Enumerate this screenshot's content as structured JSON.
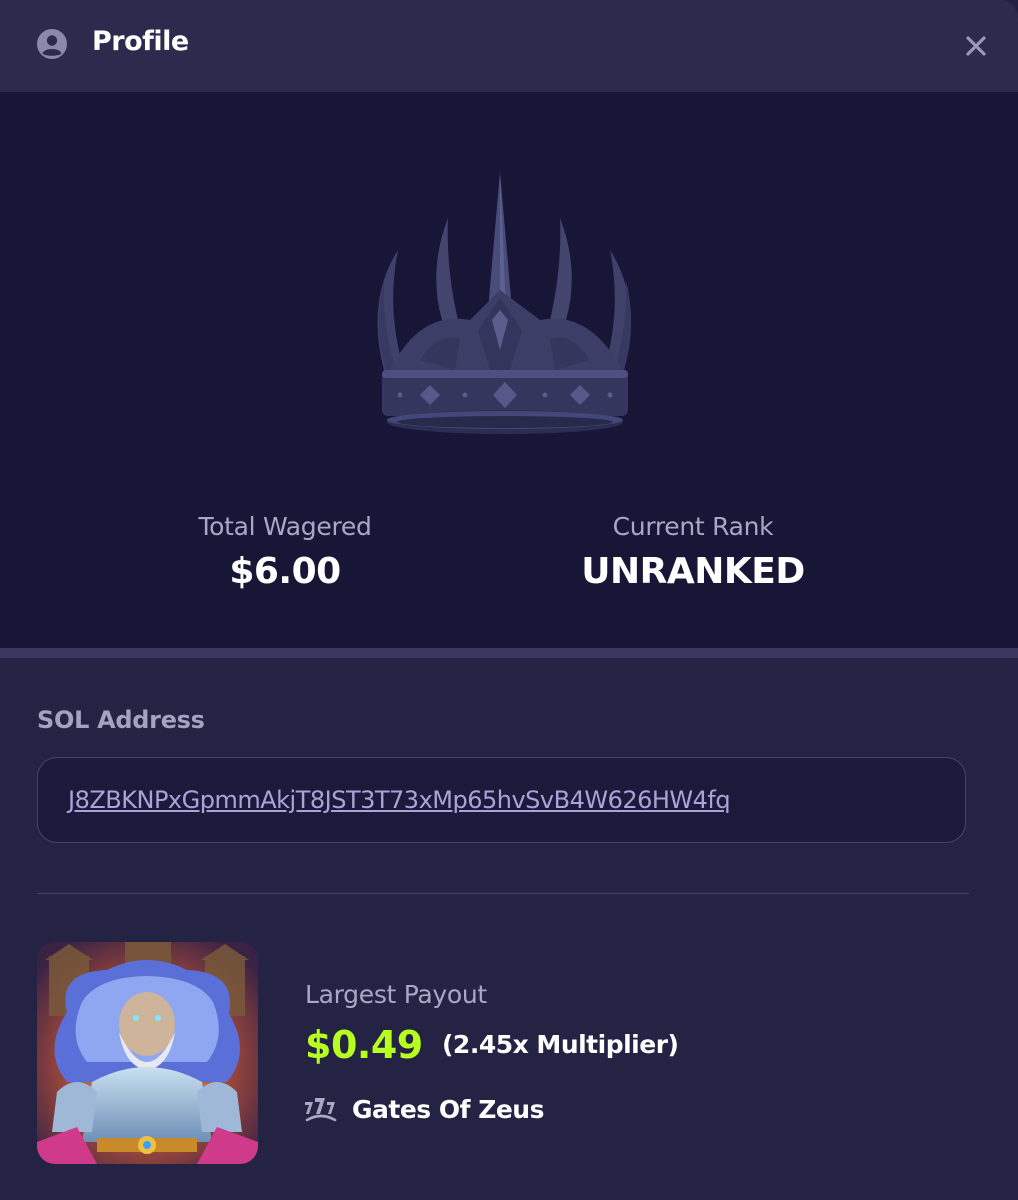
{
  "header": {
    "title": "Profile"
  },
  "stats": {
    "total_wagered_label": "Total Wagered",
    "total_wagered_value": "$6.00",
    "current_rank_label": "Current Rank",
    "current_rank_value": "UNRANKED"
  },
  "sol": {
    "label": "SOL Address",
    "address": "J8ZBKNPxGpmmAkjT8JST3T73xMp65hvSvB4W626HW4fq"
  },
  "payout": {
    "label": "Largest Payout",
    "amount": "$0.49",
    "multiplier": "(2.45x Multiplier)",
    "game_name": "Gates Of Zeus"
  },
  "icons": {
    "user": "user-circle-icon",
    "close": "close-icon",
    "game": "slot-777-icon",
    "rank": "crown-icon"
  },
  "colors": {
    "accent_green": "#b6ff1f",
    "hero_bg": "#181636",
    "panel_bg": "#252344",
    "header_bg": "#2c2a4d"
  }
}
